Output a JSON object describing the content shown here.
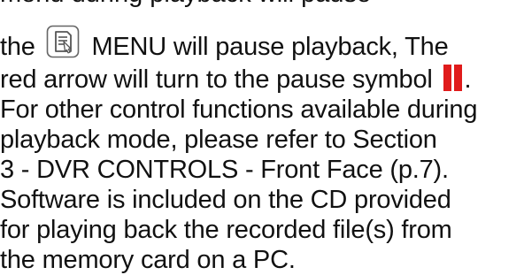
{
  "document": {
    "cut_text": "menu during playback will pause",
    "lines": [
      {
        "before_icon": "the",
        "after_icon": "MENU will pause playback, The"
      },
      {
        "text": "red arrow will turn to the pause symbol"
      },
      {
        "text": "For other control functions available during"
      },
      {
        "text": "playback mode, please refer to Section"
      },
      {
        "text": "3 - DVR CONTROLS - Front Face (p.7)."
      },
      {
        "text": "Software is included on the CD provided"
      },
      {
        "text": "for playing back the recorded file(s) from"
      },
      {
        "text": "the memory card on a PC."
      }
    ],
    "icons": {
      "menu_icon": "menu-document-icon",
      "pause_icon": "pause-icon"
    },
    "colors": {
      "text": "#111111",
      "pause": "#e01b1b",
      "icon_stroke": "#555555"
    }
  }
}
